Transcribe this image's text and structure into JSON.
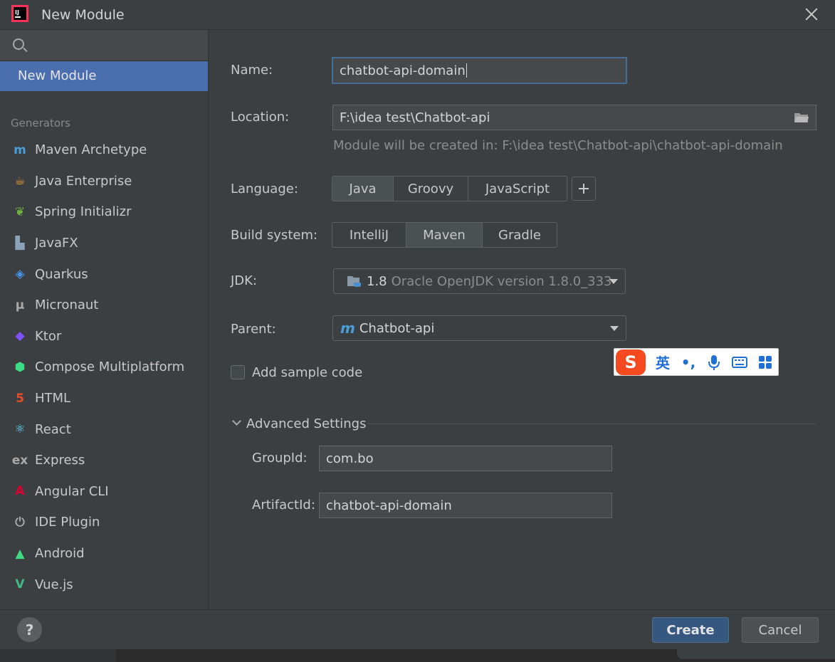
{
  "window": {
    "title": "New Module"
  },
  "sidebar": {
    "selected": "New Module",
    "group_label": "Generators",
    "items": [
      {
        "label": "Maven Archetype",
        "icon": "maven-icon",
        "glyph": "m",
        "color": "#4a9fd8"
      },
      {
        "label": "Java Enterprise",
        "icon": "java-enterprise-icon",
        "glyph": "☕",
        "color": "#f0a030"
      },
      {
        "label": "Spring Initializr",
        "icon": "spring-icon",
        "glyph": "❦",
        "color": "#6db33f"
      },
      {
        "label": "JavaFX",
        "icon": "javafx-folder-icon",
        "glyph": "▙",
        "color": "#8aa3b8"
      },
      {
        "label": "Quarkus",
        "icon": "quarkus-icon",
        "glyph": "◈",
        "color": "#4695eb"
      },
      {
        "label": "Micronaut",
        "icon": "micronaut-icon",
        "glyph": "μ",
        "color": "#a9a9a9"
      },
      {
        "label": "Ktor",
        "icon": "ktor-icon",
        "glyph": "◆",
        "color": "#7f52ff"
      },
      {
        "label": "Compose Multiplatform",
        "icon": "compose-icon",
        "glyph": "⬢",
        "color": "#3ddc84"
      },
      {
        "label": "HTML",
        "icon": "html5-icon",
        "glyph": "5",
        "color": "#e44d26"
      },
      {
        "label": "React",
        "icon": "react-icon",
        "glyph": "⚛",
        "color": "#61dafb"
      },
      {
        "label": "Express",
        "icon": "express-icon",
        "glyph": "ex",
        "color": "#a9a9a9"
      },
      {
        "label": "Angular CLI",
        "icon": "angular-icon",
        "glyph": "A",
        "color": "#dd0031"
      },
      {
        "label": "IDE Plugin",
        "icon": "plugin-icon",
        "glyph": "⏻",
        "color": "#a9a9a9"
      },
      {
        "label": "Android",
        "icon": "android-icon",
        "glyph": "▲",
        "color": "#3ddc84"
      },
      {
        "label": "Vue.js",
        "icon": "vue-icon",
        "glyph": "V",
        "color": "#41b883"
      }
    ]
  },
  "form": {
    "name_label": "Name:",
    "name_value": "chatbot-api-domain",
    "location_label": "Location:",
    "location_value": "F:\\idea test\\Chatbot-api",
    "location_hint": "Module will be created in: F:\\idea test\\Chatbot-api\\chatbot-api-domain",
    "language_label": "Language:",
    "languages": [
      "Java",
      "Groovy",
      "JavaScript"
    ],
    "language_selected": "Java",
    "build_label": "Build system:",
    "build_systems": [
      "IntelliJ",
      "Maven",
      "Gradle"
    ],
    "build_selected": "Maven",
    "jdk_label": "JDK:",
    "jdk_version": "1.8",
    "jdk_detail": "Oracle OpenJDK version 1.8.0_333",
    "parent_label": "Parent:",
    "parent_value": "Chatbot-api",
    "sample_code_label": "Add sample code",
    "sample_code_checked": false,
    "advanced_label": "Advanced Settings",
    "groupid_label": "GroupId:",
    "groupid_value": "com.bo",
    "artifactid_label": "ArtifactId:",
    "artifactid_value": "chatbot-api-domain"
  },
  "ime": {
    "logo": "S",
    "lang": "英",
    "punct": "•,",
    "items": [
      "mic-icon",
      "keyboard-icon",
      "grid-icon"
    ]
  },
  "footer": {
    "help": "?",
    "create": "Create",
    "cancel": "Cancel"
  },
  "colors": {
    "accent": "#4b6eaf",
    "primary_button": "#365880",
    "background": "#3c3f41"
  }
}
